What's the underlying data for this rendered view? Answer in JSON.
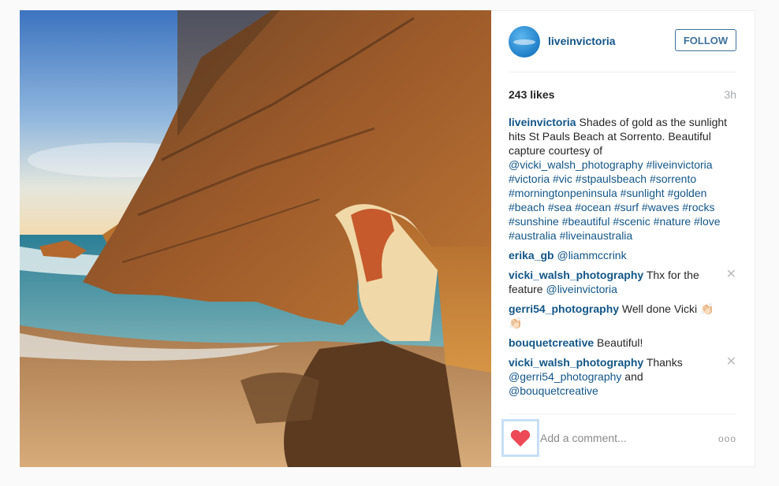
{
  "post": {
    "username": "liveinvictoria",
    "follow_label": "FOLLOW",
    "likes": "243 likes",
    "time": "3h",
    "caption": {
      "user": "liveinvictoria",
      "text": "Shades of gold as the sunlight hits St Pauls Beach at Sorrento. Beautiful capture courtesy of ",
      "tags": "@vicki_walsh_photography #liveinvictoria #victoria #vic #stpaulsbeach #sorrento #morningtonpeninsula #sunlight #golden #beach #sea #ocean #surf #waves #rocks #sunshine #beautiful #scenic #nature #love #australia #liveinaustralia"
    },
    "comments": [
      {
        "user": "erika_gb",
        "text_pre": "",
        "tags": "@liammccrink",
        "text_post": "",
        "deletable": false
      },
      {
        "user": "vicki_walsh_photography",
        "text_pre": "Thx for the feature ",
        "tags": "@liveinvictoria",
        "text_post": "",
        "deletable": true
      },
      {
        "user": "gerri54_photography",
        "text_pre": "Well done Vicki 👏🏻👏🏻",
        "tags": "",
        "text_post": "",
        "deletable": false
      },
      {
        "user": "bouquetcreative",
        "text_pre": "Beautiful!",
        "tags": "",
        "text_post": "",
        "deletable": false
      },
      {
        "user": "vicki_walsh_photography",
        "text_pre": "Thanks ",
        "tags": "@gerri54_photography",
        "text_post": " and ",
        "tags2": "@bouquetcreative",
        "deletable": true
      }
    ],
    "add_comment_placeholder": "Add a comment...",
    "more_label": "ooo",
    "delete_glyph": "✕"
  },
  "icons": {
    "like": "heart-icon",
    "more": "more-options-icon",
    "delete": "close-icon"
  },
  "colors": {
    "link": "#125688",
    "follow": "#3f729b",
    "heart": "#ed4956",
    "muted": "#a5a7aa"
  }
}
